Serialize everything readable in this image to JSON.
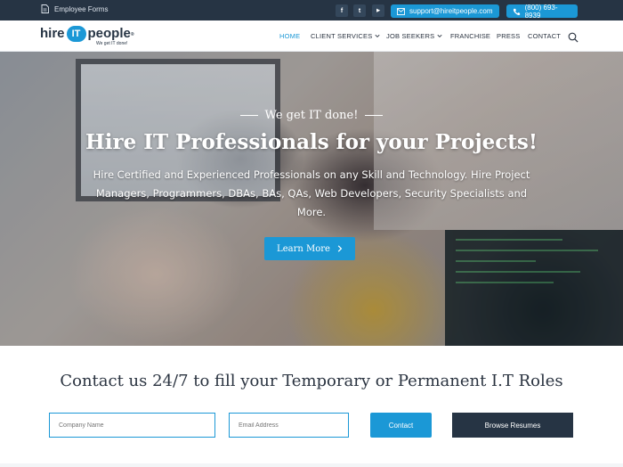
{
  "topbar": {
    "employee_forms_label": "Employee Forms",
    "social_icons": [
      "facebook-icon",
      "twitter-icon",
      "youtube-icon"
    ],
    "social_glyphs": [
      "f",
      "t",
      "▶"
    ],
    "email": "support@hireitpeople.com",
    "phone": "(800) 693-8939"
  },
  "logo": {
    "word_hire": "hire",
    "word_it": "IT",
    "word_people": "people",
    "trademark": "®",
    "tagline": "We get IT done!"
  },
  "nav": {
    "items": [
      {
        "label": "HOME",
        "active": true,
        "dropdown": false
      },
      {
        "label": "CLIENT SERVICES",
        "active": false,
        "dropdown": true
      },
      {
        "label": "JOB SEEKERS",
        "active": false,
        "dropdown": true
      },
      {
        "label": "FRANCHISE",
        "active": false,
        "dropdown": false
      },
      {
        "label": "PRESS",
        "active": false,
        "dropdown": false
      },
      {
        "label": "CONTACT",
        "active": false,
        "dropdown": false
      }
    ]
  },
  "hero": {
    "tagline": "We get IT done!",
    "title": "Hire IT Professionals for your Projects!",
    "subtitle": "Hire Certified and Experienced Professionals on any Skill and Technology. Hire Project Managers, Programmers, DBAs, BAs, QAs, Web Developers, Security Specialists and More.",
    "cta_label": "Learn More"
  },
  "contact": {
    "heading": "Contact us 24/7 to fill your Temporary or Permanent I.T Roles",
    "company_placeholder": "Company Name",
    "email_placeholder": "Email Address",
    "contact_button": "Contact",
    "browse_button": "Browse Resumes"
  },
  "colors": {
    "accent": "#1b98d6",
    "dark": "#263444",
    "text": "#2a3340"
  }
}
